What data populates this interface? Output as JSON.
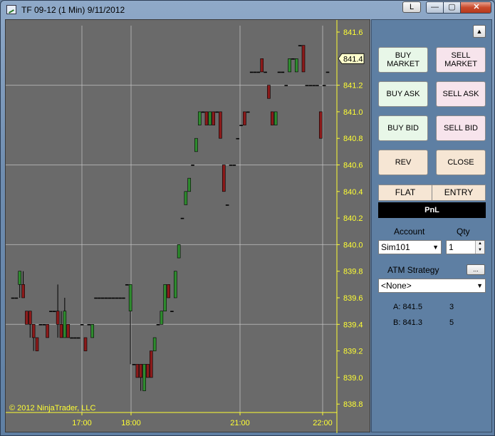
{
  "window": {
    "title": "TF 09-12 (1 Min)  9/11/2012",
    "link_button": "L",
    "min_glyph": "—",
    "max_glyph": "▢",
    "close_glyph": "✕"
  },
  "colors": {
    "chart_bg": "#6a6a6a",
    "axis_text": "#ffff33",
    "up_bar": "#2e8b2e",
    "down_bar": "#8b1a1a",
    "grid": "#c8c8c8"
  },
  "chart": {
    "copyright": "© 2012 NinjaTrader, LLC",
    "current_price_label": "841.4"
  },
  "chart_data": {
    "type": "candlestick",
    "instrument": "TF 09-12",
    "interval": "1 Min",
    "ylim": [
      838.7,
      841.65
    ],
    "y_ticks": [
      "841.6",
      "841.2",
      "841.0",
      "840.8",
      "840.6",
      "840.4",
      "840.2",
      "840.0",
      "839.8",
      "839.6",
      "839.4",
      "839.2",
      "839.0",
      "838.8"
    ],
    "x_ticks": [
      "17:00",
      "18:00",
      "21:00",
      "22:00"
    ],
    "current_price": 841.4,
    "bars": [
      {
        "o": 839.6,
        "h": 839.6,
        "l": 839.6,
        "c": 839.6
      },
      {
        "o": 839.6,
        "h": 839.6,
        "l": 839.6,
        "c": 839.6
      },
      {
        "o": 839.7,
        "h": 839.8,
        "l": 839.6,
        "c": 839.8
      },
      {
        "o": 839.7,
        "h": 839.8,
        "l": 839.6,
        "c": 839.6
      },
      {
        "o": 839.5,
        "h": 839.5,
        "l": 839.4,
        "c": 839.4
      },
      {
        "o": 839.5,
        "h": 839.5,
        "l": 839.3,
        "c": 839.4
      },
      {
        "o": 839.4,
        "h": 839.4,
        "l": 839.2,
        "c": 839.3
      },
      {
        "o": 839.3,
        "h": 839.3,
        "l": 839.2,
        "c": 839.2
      },
      {
        "o": 839.4,
        "h": 839.4,
        "l": 839.4,
        "c": 839.4
      },
      {
        "o": 839.4,
        "h": 839.4,
        "l": 839.4,
        "c": 839.4
      },
      {
        "o": 839.4,
        "h": 839.4,
        "l": 839.3,
        "c": 839.3
      },
      {
        "o": 839.5,
        "h": 839.5,
        "l": 839.5,
        "c": 839.5
      },
      {
        "o": 839.5,
        "h": 839.5,
        "l": 839.5,
        "c": 839.5
      },
      {
        "o": 839.5,
        "h": 839.7,
        "l": 839.3,
        "c": 839.4
      },
      {
        "o": 839.4,
        "h": 839.5,
        "l": 839.3,
        "c": 839.3
      },
      {
        "o": 839.3,
        "h": 839.6,
        "l": 839.3,
        "c": 839.5
      },
      {
        "o": 839.4,
        "h": 839.4,
        "l": 839.3,
        "c": 839.3
      },
      {
        "o": 839.3,
        "h": 839.3,
        "l": 839.3,
        "c": 839.3
      },
      {
        "o": 839.3,
        "h": 839.3,
        "l": 839.3,
        "c": 839.3
      },
      {
        "o": 839.3,
        "h": 839.3,
        "l": 839.3,
        "c": 839.3
      },
      {
        "o": 839.4,
        "h": 839.4,
        "l": 839.4,
        "c": 839.4
      },
      {
        "o": 839.3,
        "h": 839.3,
        "l": 839.2,
        "c": 839.2
      },
      {
        "o": 839.4,
        "h": 839.4,
        "l": 839.4,
        "c": 839.4
      },
      {
        "o": 839.3,
        "h": 839.4,
        "l": 839.3,
        "c": 839.4
      },
      {
        "o": 839.6,
        "h": 839.6,
        "l": 839.6,
        "c": 839.6
      },
      {
        "o": 839.6,
        "h": 839.6,
        "l": 839.6,
        "c": 839.6
      },
      {
        "o": 839.6,
        "h": 839.6,
        "l": 839.6,
        "c": 839.6
      },
      {
        "o": 839.6,
        "h": 839.6,
        "l": 839.6,
        "c": 839.6
      },
      {
        "o": 839.6,
        "h": 839.6,
        "l": 839.6,
        "c": 839.6
      },
      {
        "o": 839.6,
        "h": 839.6,
        "l": 839.6,
        "c": 839.6
      },
      {
        "o": 839.6,
        "h": 839.6,
        "l": 839.6,
        "c": 839.6
      },
      {
        "o": 839.6,
        "h": 839.6,
        "l": 839.6,
        "c": 839.6
      },
      {
        "o": 839.6,
        "h": 839.6,
        "l": 839.6,
        "c": 839.6
      },
      {
        "o": 839.7,
        "h": 839.7,
        "l": 839.7,
        "c": 839.7
      },
      {
        "o": 839.5,
        "h": 839.7,
        "l": 839.1,
        "c": 839.7
      },
      {
        "o": 839.1,
        "h": 839.1,
        "l": 839.1,
        "c": 839.1
      },
      {
        "o": 839.1,
        "h": 839.1,
        "l": 839.0,
        "c": 839.0
      },
      {
        "o": 839.1,
        "h": 839.1,
        "l": 838.9,
        "c": 839.0
      },
      {
        "o": 838.9,
        "h": 839.1,
        "l": 838.9,
        "c": 839.1
      },
      {
        "o": 839.1,
        "h": 839.1,
        "l": 839.0,
        "c": 839.0
      },
      {
        "o": 839.2,
        "h": 839.2,
        "l": 839.0,
        "c": 839.0
      },
      {
        "o": 839.2,
        "h": 839.3,
        "l": 839.2,
        "c": 839.3
      },
      {
        "o": 839.4,
        "h": 839.4,
        "l": 839.4,
        "c": 839.4
      },
      {
        "o": 839.4,
        "h": 839.5,
        "l": 839.4,
        "c": 839.5
      },
      {
        "o": 839.5,
        "h": 839.7,
        "l": 839.5,
        "c": 839.7
      },
      {
        "o": 839.7,
        "h": 839.7,
        "l": 839.6,
        "c": 839.6
      },
      {
        "o": 839.5,
        "h": 839.5,
        "l": 839.5,
        "c": 839.5
      },
      {
        "o": 839.6,
        "h": 839.8,
        "l": 839.6,
        "c": 839.8
      },
      {
        "o": 839.9,
        "h": 840.0,
        "l": 839.9,
        "c": 840.0
      },
      {
        "o": 840.2,
        "h": 840.2,
        "l": 840.2,
        "c": 840.2
      },
      {
        "o": 840.3,
        "h": 840.4,
        "l": 840.3,
        "c": 840.4
      },
      {
        "o": 840.4,
        "h": 840.5,
        "l": 840.4,
        "c": 840.5
      },
      {
        "o": 840.6,
        "h": 840.6,
        "l": 840.6,
        "c": 840.6
      },
      {
        "o": 840.7,
        "h": 840.8,
        "l": 840.7,
        "c": 840.8
      },
      {
        "o": 840.9,
        "h": 841.0,
        "l": 840.9,
        "c": 841.0
      },
      {
        "o": 841.0,
        "h": 841.0,
        "l": 841.0,
        "c": 841.0
      },
      {
        "o": 841.0,
        "h": 841.0,
        "l": 840.9,
        "c": 840.9
      },
      {
        "o": 840.9,
        "h": 841.0,
        "l": 840.9,
        "c": 841.0
      },
      {
        "o": 841.0,
        "h": 841.0,
        "l": 840.9,
        "c": 840.9
      },
      {
        "o": 841.0,
        "h": 841.0,
        "l": 841.0,
        "c": 841.0
      },
      {
        "o": 841.0,
        "h": 841.0,
        "l": 840.8,
        "c": 840.8
      },
      {
        "o": 840.6,
        "h": 840.6,
        "l": 840.4,
        "c": 840.4
      },
      {
        "o": 840.3,
        "h": 840.3,
        "l": 840.3,
        "c": 840.3
      },
      {
        "o": 840.6,
        "h": 840.6,
        "l": 840.6,
        "c": 840.6
      },
      {
        "o": 840.6,
        "h": 840.6,
        "l": 840.6,
        "c": 840.6
      },
      {
        "o": 840.8,
        "h": 840.8,
        "l": 840.8,
        "c": 840.8
      },
      {
        "o": 840.9,
        "h": 840.9,
        "l": 840.9,
        "c": 840.9
      },
      {
        "o": 841.0,
        "h": 841.0,
        "l": 840.9,
        "c": 840.9
      },
      {
        "o": 841.0,
        "h": 841.0,
        "l": 841.0,
        "c": 841.0
      },
      {
        "o": 841.3,
        "h": 841.3,
        "l": 841.3,
        "c": 841.3
      },
      {
        "o": 841.3,
        "h": 841.3,
        "l": 841.3,
        "c": 841.3
      },
      {
        "o": 841.3,
        "h": 841.3,
        "l": 841.3,
        "c": 841.3
      },
      {
        "o": 841.4,
        "h": 841.4,
        "l": 841.3,
        "c": 841.3
      },
      {
        "o": 841.3,
        "h": 841.3,
        "l": 841.3,
        "c": 841.3
      },
      {
        "o": 841.2,
        "h": 841.2,
        "l": 841.1,
        "c": 841.1
      },
      {
        "o": 841.0,
        "h": 841.0,
        "l": 840.9,
        "c": 840.9
      },
      {
        "o": 840.9,
        "h": 841.0,
        "l": 840.9,
        "c": 841.0
      },
      {
        "o": 841.3,
        "h": 841.3,
        "l": 841.3,
        "c": 841.3
      },
      {
        "o": 841.3,
        "h": 841.3,
        "l": 841.3,
        "c": 841.3
      },
      {
        "o": 841.2,
        "h": 841.2,
        "l": 841.2,
        "c": 841.2
      },
      {
        "o": 841.3,
        "h": 841.4,
        "l": 841.3,
        "c": 841.4
      },
      {
        "o": 841.4,
        "h": 841.4,
        "l": 841.4,
        "c": 841.4
      },
      {
        "o": 841.3,
        "h": 841.4,
        "l": 841.3,
        "c": 841.4
      },
      {
        "o": 841.5,
        "h": 841.5,
        "l": 841.5,
        "c": 841.5
      },
      {
        "o": 841.5,
        "h": 841.5,
        "l": 841.3,
        "c": 841.3
      },
      {
        "o": 841.2,
        "h": 841.2,
        "l": 841.2,
        "c": 841.2
      },
      {
        "o": 841.2,
        "h": 841.2,
        "l": 841.2,
        "c": 841.2
      },
      {
        "o": 841.2,
        "h": 841.2,
        "l": 841.2,
        "c": 841.2
      },
      {
        "o": 841.2,
        "h": 841.2,
        "l": 841.2,
        "c": 841.2
      },
      {
        "o": 841.0,
        "h": 841.0,
        "l": 840.8,
        "c": 840.8
      },
      {
        "o": 841.2,
        "h": 841.2,
        "l": 841.2,
        "c": 841.2
      },
      {
        "o": 841.3,
        "h": 841.3,
        "l": 841.3,
        "c": 841.3
      }
    ]
  },
  "panel": {
    "buy_market": "BUY\nMARKET",
    "sell_market": "SELL\nMARKET",
    "buy_ask": "BUY ASK",
    "sell_ask": "SELL ASK",
    "buy_bid": "BUY BID",
    "sell_bid": "SELL BID",
    "rev": "REV",
    "close": "CLOSE",
    "flat": "FLAT",
    "entry": "ENTRY",
    "pnl": "PnL",
    "account_label": "Account",
    "qty_label": "Qty",
    "account_value": "Sim101",
    "qty_value": "1",
    "atm_label": "ATM Strategy",
    "atm_button": "...",
    "atm_value": "<None>",
    "ask_label": "A: 841.5",
    "ask_size": "3",
    "bid_label": "B: 841.3",
    "bid_size": "5",
    "scroll_up_glyph": "▲",
    "dropdown_glyph": "▼",
    "spin_up_glyph": "▲",
    "spin_down_glyph": "▼"
  }
}
